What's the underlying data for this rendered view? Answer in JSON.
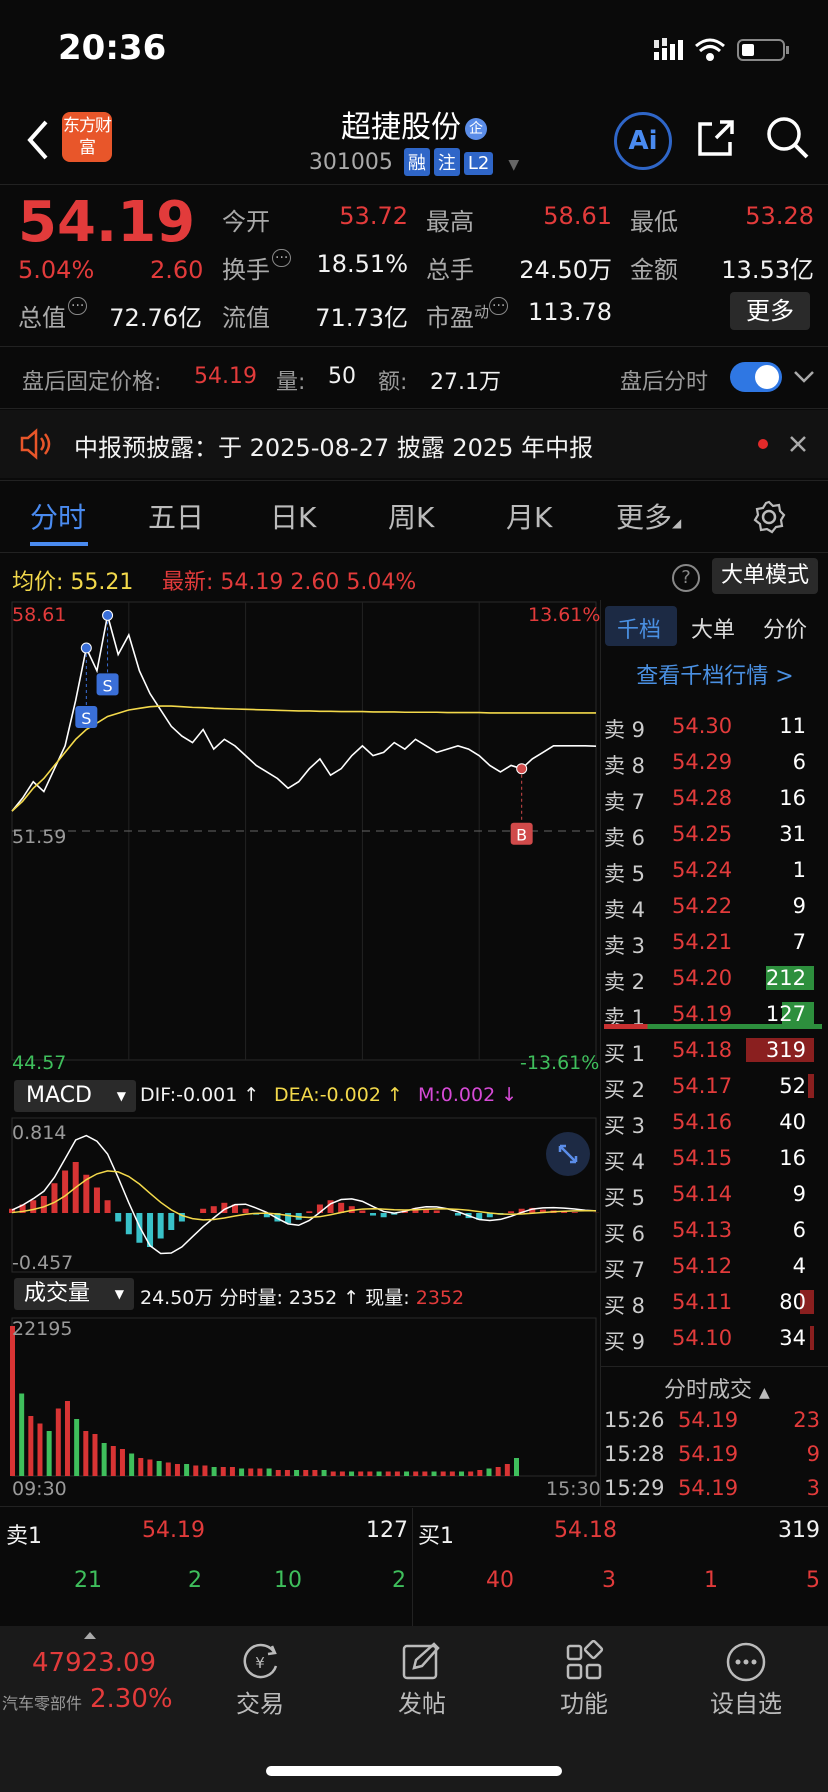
{
  "status": {
    "time": "20:36"
  },
  "header": {
    "logo": "东方财富",
    "title": "超捷股份",
    "title_badge": "企",
    "code": "301005",
    "tags": [
      "融",
      "注",
      "L2"
    ],
    "ai_label": "Ai"
  },
  "quote": {
    "price": "54.19",
    "change_pct": "5.04%",
    "change": "2.60",
    "open_label": "今开",
    "open": "53.72",
    "high_label": "最高",
    "high": "58.61",
    "low_label": "最低",
    "low": "53.28",
    "turnover_label": "换手",
    "turnover": "18.51%",
    "volume_label": "总手",
    "volume": "24.50万",
    "amount_label": "金额",
    "amount": "13.53亿",
    "mcap_label": "总值",
    "mcap": "72.76亿",
    "float_label": "流值",
    "float": "71.73亿",
    "pe_label": "市盈",
    "pe_sup": "动",
    "pe": "113.78",
    "more": "更多"
  },
  "afterhours": {
    "label": "盘后固定价格:",
    "price": "54.19",
    "qty_label": "量:",
    "qty": "50",
    "amt_label": "额:",
    "amt": "27.1万",
    "toggle_label": "盘后分时"
  },
  "notice": {
    "text": "中报预披露：于 2025-08-27 披露 2025 年中报"
  },
  "tabs": [
    "分时",
    "五日",
    "日K",
    "周K",
    "月K",
    "更多"
  ],
  "chart_info": {
    "avg_label": "均价:",
    "avg": "55.21",
    "latest_label": "最新:",
    "latest": "54.19",
    "latest_change": "2.60",
    "latest_pct": "5.04%",
    "mode": "大单模式"
  },
  "chart_data": {
    "type": "line",
    "y_top": "58.61",
    "y_mid": "51.59",
    "y_bottom": "44.57",
    "pct_top": "13.61%",
    "pct_bottom": "-13.61%",
    "x_start": "09:30",
    "x_end": "15:30",
    "ylim": [
      44.57,
      58.61
    ],
    "price": [
      52.2,
      52.6,
      53.1,
      52.8,
      53.5,
      54.2,
      55.6,
      57.2,
      56.5,
      58.2,
      57.0,
      57.6,
      56.5,
      55.8,
      55.3,
      54.8,
      54.5,
      54.3,
      54.7,
      54.1,
      54.4,
      54.2,
      53.9,
      53.6,
      53.4,
      53.2,
      52.9,
      53.1,
      53.5,
      53.8,
      53.3,
      53.5,
      53.9,
      54.2,
      53.9,
      54.0,
      54.3,
      54.1,
      54.4,
      54.2,
      54.0,
      54.1,
      54.2,
      54.1,
      53.9,
      53.6,
      53.4,
      53.6,
      53.5,
      53.8,
      54.0,
      54.2,
      54.2,
      54.2,
      54.2,
      54.19
    ],
    "avg": [
      52.2,
      52.5,
      52.9,
      53.2,
      53.6,
      54.0,
      54.4,
      54.7,
      54.9,
      55.1,
      55.2,
      55.3,
      55.35,
      55.4,
      55.42,
      55.42,
      55.4,
      55.38,
      55.37,
      55.35,
      55.34,
      55.33,
      55.32,
      55.31,
      55.3,
      55.29,
      55.28,
      55.27,
      55.27,
      55.26,
      55.26,
      55.25,
      55.25,
      55.25,
      55.24,
      55.24,
      55.24,
      55.23,
      55.23,
      55.23,
      55.23,
      55.22,
      55.22,
      55.22,
      55.22,
      55.21,
      55.21,
      55.21,
      55.21,
      55.21,
      55.21,
      55.21,
      55.21,
      55.21,
      55.21,
      55.21
    ],
    "markers": [
      {
        "label": "S"
      },
      {
        "label": "S"
      },
      {
        "label": "B"
      }
    ]
  },
  "macd": {
    "label": "MACD",
    "dif_label": "DIF:",
    "dif": "-0.001 ↑",
    "dea_label": "DEA:",
    "dea": "-0.002 ↑",
    "m_label": "M:",
    "m": "0.002 ↓",
    "top": "0.814",
    "bottom": "-0.457",
    "bars": [
      0.05,
      0.1,
      0.15,
      0.2,
      0.35,
      0.5,
      0.6,
      0.45,
      0.3,
      0.15,
      -0.1,
      -0.25,
      -0.35,
      -0.4,
      -0.3,
      -0.2,
      -0.1,
      0.0,
      0.05,
      0.08,
      0.12,
      0.1,
      0.05,
      -0.02,
      -0.05,
      -0.1,
      -0.12,
      -0.08,
      0.02,
      0.1,
      0.15,
      0.12,
      0.08,
      0.03,
      -0.03,
      -0.05,
      -0.02,
      0.03,
      0.06,
      0.05,
      0.03,
      0.0,
      -0.03,
      -0.06,
      -0.08,
      -0.05,
      -0.02,
      0.02,
      0.05,
      0.06,
      0.04,
      0.03,
      0.02,
      0.01,
      0.0,
      0.002
    ]
  },
  "volume": {
    "label": "成交量",
    "total": "24.50万",
    "fen_label": "分时量:",
    "fen": "2352 ↑",
    "now_label": "现量:",
    "now": "2352",
    "top": "22195",
    "bars": [
      1.0,
      0.55,
      0.4,
      0.35,
      0.3,
      0.45,
      0.5,
      0.38,
      0.3,
      0.28,
      0.22,
      0.2,
      0.18,
      0.15,
      0.12,
      0.11,
      0.1,
      0.09,
      0.08,
      0.08,
      0.07,
      0.07,
      0.06,
      0.06,
      0.06,
      0.05,
      0.05,
      0.05,
      0.05,
      0.04,
      0.04,
      0.04,
      0.04,
      0.04,
      0.04,
      0.03,
      0.03,
      0.03,
      0.03,
      0.03,
      0.03,
      0.03,
      0.03,
      0.03,
      0.03,
      0.03,
      0.03,
      0.03,
      0.03,
      0.03,
      0.03,
      0.04,
      0.05,
      0.06,
      0.08,
      0.12
    ]
  },
  "orderbook": {
    "tabs": [
      "千档",
      "大单",
      "分价"
    ],
    "link": "查看千档行情 >",
    "sells": [
      {
        "label": "卖 9",
        "price": "54.30",
        "vol": "11"
      },
      {
        "label": "卖 8",
        "price": "54.29",
        "vol": "6"
      },
      {
        "label": "卖 7",
        "price": "54.28",
        "vol": "16"
      },
      {
        "label": "卖 6",
        "price": "54.25",
        "vol": "31"
      },
      {
        "label": "卖 5",
        "price": "54.24",
        "vol": "1"
      },
      {
        "label": "卖 4",
        "price": "54.22",
        "vol": "9"
      },
      {
        "label": "卖 3",
        "price": "54.21",
        "vol": "7"
      },
      {
        "label": "卖 2",
        "price": "54.20",
        "vol": "212"
      },
      {
        "label": "卖 1",
        "price": "54.19",
        "vol": "127"
      }
    ],
    "buys": [
      {
        "label": "买 1",
        "price": "54.18",
        "vol": "319"
      },
      {
        "label": "买 2",
        "price": "54.17",
        "vol": "52"
      },
      {
        "label": "买 3",
        "price": "54.16",
        "vol": "40"
      },
      {
        "label": "买 4",
        "price": "54.15",
        "vol": "16"
      },
      {
        "label": "买 5",
        "price": "54.14",
        "vol": "9"
      },
      {
        "label": "买 6",
        "price": "54.13",
        "vol": "6"
      },
      {
        "label": "买 7",
        "price": "54.12",
        "vol": "4"
      },
      {
        "label": "买 8",
        "price": "54.11",
        "vol": "80"
      },
      {
        "label": "买 9",
        "price": "54.10",
        "vol": "34"
      }
    ],
    "trades_title": "分时成交",
    "trades": [
      {
        "time": "15:26",
        "price": "54.19",
        "vol": "23"
      },
      {
        "time": "15:28",
        "price": "54.19",
        "vol": "9"
      },
      {
        "time": "15:29",
        "price": "54.19",
        "vol": "3"
      }
    ]
  },
  "bottom_quote": {
    "sell_label": "卖1",
    "sell_price": "54.19",
    "sell_vol": "127",
    "buy_label": "买1",
    "buy_price": "54.18",
    "buy_vol": "319",
    "sell_breakdown": [
      "21",
      "2",
      "10",
      "2"
    ],
    "buy_breakdown": [
      "40",
      "3",
      "1",
      "5"
    ]
  },
  "bottom_nav": {
    "index_value": "47923.09",
    "index_name": "汽车零部件",
    "index_pct": "2.30%",
    "items": [
      "交易",
      "发帖",
      "功能",
      "设自选"
    ]
  }
}
